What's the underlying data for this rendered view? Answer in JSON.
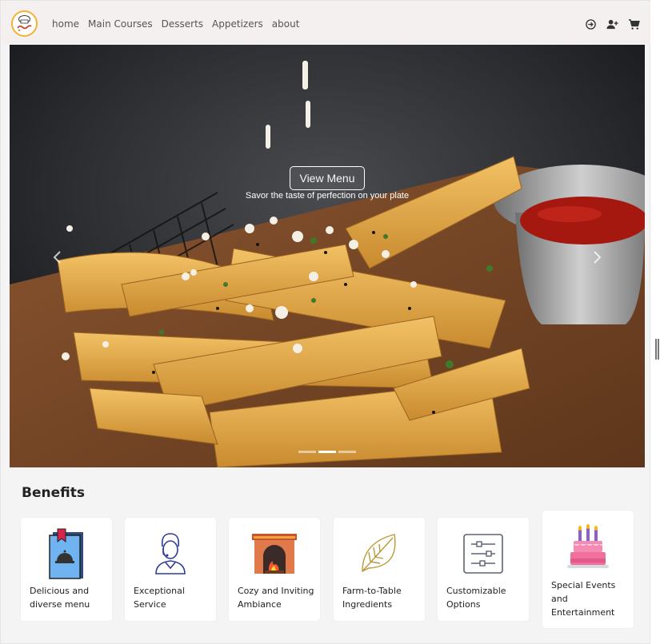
{
  "nav": {
    "links": [
      "home",
      "Main Courses",
      "Desserts",
      "Appetizers",
      "about"
    ],
    "icons": [
      "login-icon",
      "add-user-icon",
      "cart-icon"
    ]
  },
  "hero": {
    "button_label": "View Menu",
    "tagline": "Savor the taste of perfection on your plate",
    "slide_count": 3,
    "active_slide": 2
  },
  "benefits": {
    "title": "Benefits",
    "items": [
      {
        "label": "Delicious and diverse menu",
        "icon": "menu-book-icon"
      },
      {
        "label": "Exceptional Service",
        "icon": "waiter-icon"
      },
      {
        "label": "Cozy and Inviting Ambiance",
        "icon": "fireplace-icon"
      },
      {
        "label": "Farm-to-Table Ingredients",
        "icon": "leaf-icon"
      },
      {
        "label": "Customizable Options",
        "icon": "sliders-icon"
      },
      {
        "label": "Special Events and Entertainment",
        "icon": "cake-icon"
      }
    ]
  }
}
